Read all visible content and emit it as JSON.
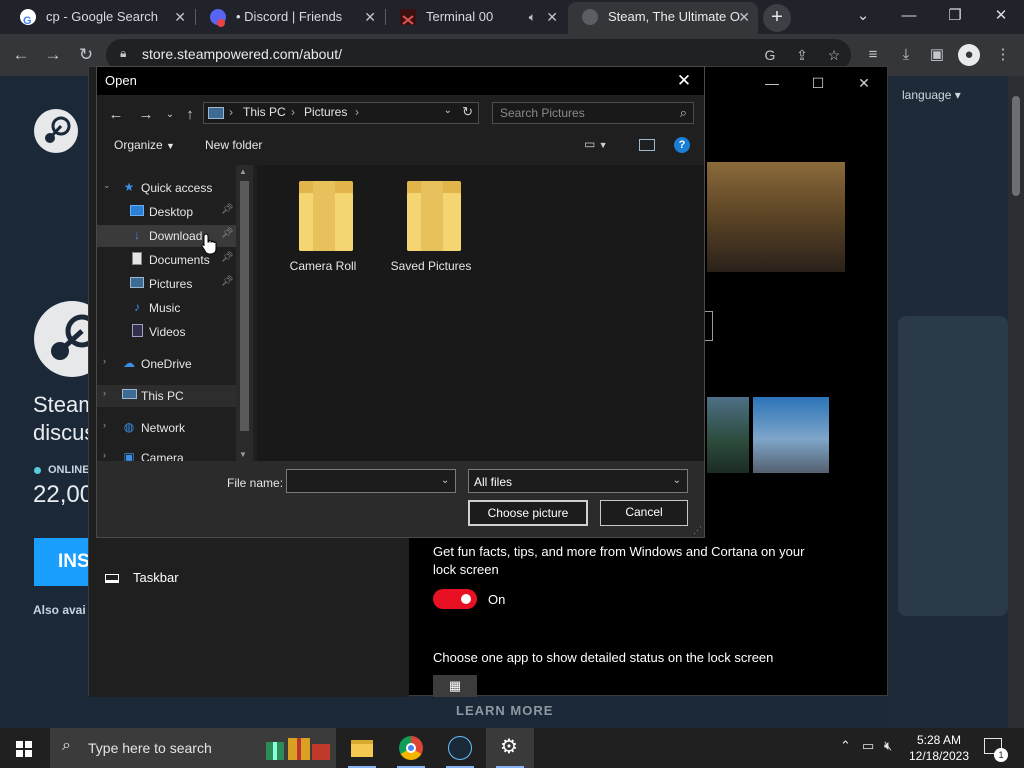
{
  "browser": {
    "tabs": [
      {
        "title": "cp - Google Search",
        "icon": "google-icon",
        "active": false
      },
      {
        "title": "• Discord | Friends",
        "icon": "discord-icon",
        "active": false
      },
      {
        "title": "Terminal 00",
        "icon": "terminal-icon",
        "active": false
      },
      {
        "title": "Steam, The Ultimate O",
        "icon": "steam-icon",
        "active": true
      }
    ],
    "url": "store.steampowered.com/about/"
  },
  "steam_page": {
    "language_label": "language",
    "headline_line1": "Steam",
    "headline_line2": "discus",
    "online_label": "ONLINE",
    "online_count": "22,00",
    "install_label": "INS",
    "also_available": "Also avai",
    "learn_more": "LEARN MORE"
  },
  "settings_window": {
    "fun_facts_text_1": "Get fun facts, tips, and more from Windows and Cortana on your",
    "fun_facts_text_2": "lock screen",
    "toggle_state": "On",
    "detailed_status_text": "Choose one app to show detailed status on the lock screen",
    "taskbar_item": "Taskbar"
  },
  "dialog": {
    "title": "Open",
    "breadcrumb": [
      "This PC",
      "Pictures"
    ],
    "search_placeholder": "Search Pictures",
    "organize_label": "Organize",
    "new_folder_label": "New folder",
    "nav_items": [
      {
        "label": "Quick access",
        "icon": "star-icon",
        "color": "#3b8fe4"
      },
      {
        "label": "Desktop",
        "icon": "desktop-icon",
        "color": "#2b7fd8"
      },
      {
        "label": "Download",
        "icon": "download-arrow-icon",
        "color": "#3a8ee6"
      },
      {
        "label": "Documents",
        "icon": "documents-icon",
        "color": "#cfcfcf"
      },
      {
        "label": "Pictures",
        "icon": "pictures-icon",
        "color": "#9bb7d1"
      },
      {
        "label": "Music",
        "icon": "music-note-icon",
        "color": "#3a8ee6"
      },
      {
        "label": "Videos",
        "icon": "videos-icon",
        "color": "#a0a0c8"
      },
      {
        "label": "OneDrive",
        "icon": "cloud-icon",
        "color": "#3a8ee6"
      },
      {
        "label": "This PC",
        "icon": "pc-icon",
        "color": "#9bb7d1"
      },
      {
        "label": "Network",
        "icon": "network-icon",
        "color": "#3a8ee6"
      },
      {
        "label": "Camera",
        "icon": "camera-icon",
        "color": "#3a8ee6"
      }
    ],
    "folders": [
      {
        "name": "Camera Roll"
      },
      {
        "name": "Saved Pictures"
      }
    ],
    "file_name_label": "File name:",
    "file_name_value": "",
    "file_type": "All files",
    "choose_label": "Choose picture",
    "cancel_label": "Cancel"
  },
  "taskbar": {
    "search_placeholder": "Type here to search",
    "time": "5:28 AM",
    "date": "12/18/2023",
    "notification_count": "1"
  },
  "colors": {
    "accent_blue": "#1a9fff",
    "toggle_red": "#e81123",
    "folder_yellow": "#f5d571"
  }
}
